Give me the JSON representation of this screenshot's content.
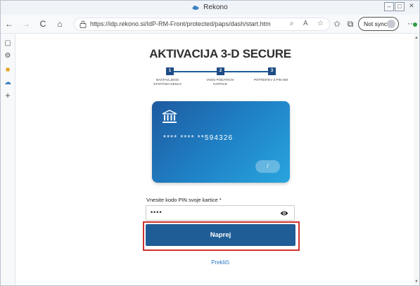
{
  "window": {
    "title": "Rekono",
    "controls": {
      "minimize": "–",
      "maximize": "□",
      "close": "✕"
    }
  },
  "toolbar": {
    "back_icon": "←",
    "forward_icon": "→",
    "refresh_icon": "C",
    "home_icon": "⌂",
    "url": "https://idp.rekono.si/IdP-RM-Front/protected/paps/dash/start.htm",
    "search_icon": "⌕",
    "read_aloud_icon": "A",
    "favorites_icon": "☆",
    "favorites_bar_icon": "✩",
    "collections_icon": "⧉",
    "sync_label": "Not syncing",
    "more_icon": "···"
  },
  "sidebar": {
    "items": [
      {
        "icon": "tabs-icon",
        "glyph": "▢"
      },
      {
        "icon": "settings-icon",
        "glyph": "⚙"
      },
      {
        "icon": "office-icon",
        "glyph": "■"
      },
      {
        "icon": "rekono-icon",
        "glyph": "☁"
      },
      {
        "icon": "add-icon",
        "glyph": "+"
      }
    ]
  },
  "page": {
    "title": "AKTIVACIJA 3-D SECURE",
    "steps": [
      {
        "number": "1",
        "label": "NASTAVLJENO STATIČNO GESLO"
      },
      {
        "number": "2",
        "label": "VNOS PODATKOV KARTICE"
      },
      {
        "number": "3",
        "label": "POTRDITEV Z PIN-OM"
      }
    ],
    "card": {
      "number": "**** **** **594326",
      "expiry": "/"
    },
    "pin": {
      "label": "Vnesite kodo PIN svoje kartice *",
      "value": "••••"
    },
    "submit_label": "Naprej",
    "cancel_label": "Prekliči"
  },
  "colors": {
    "primary": "#1f5d97",
    "highlight": "#d0312d",
    "link": "#2d79c7",
    "card_gradient_start": "#1e5aa0",
    "card_gradient_end": "#29a5dd"
  }
}
